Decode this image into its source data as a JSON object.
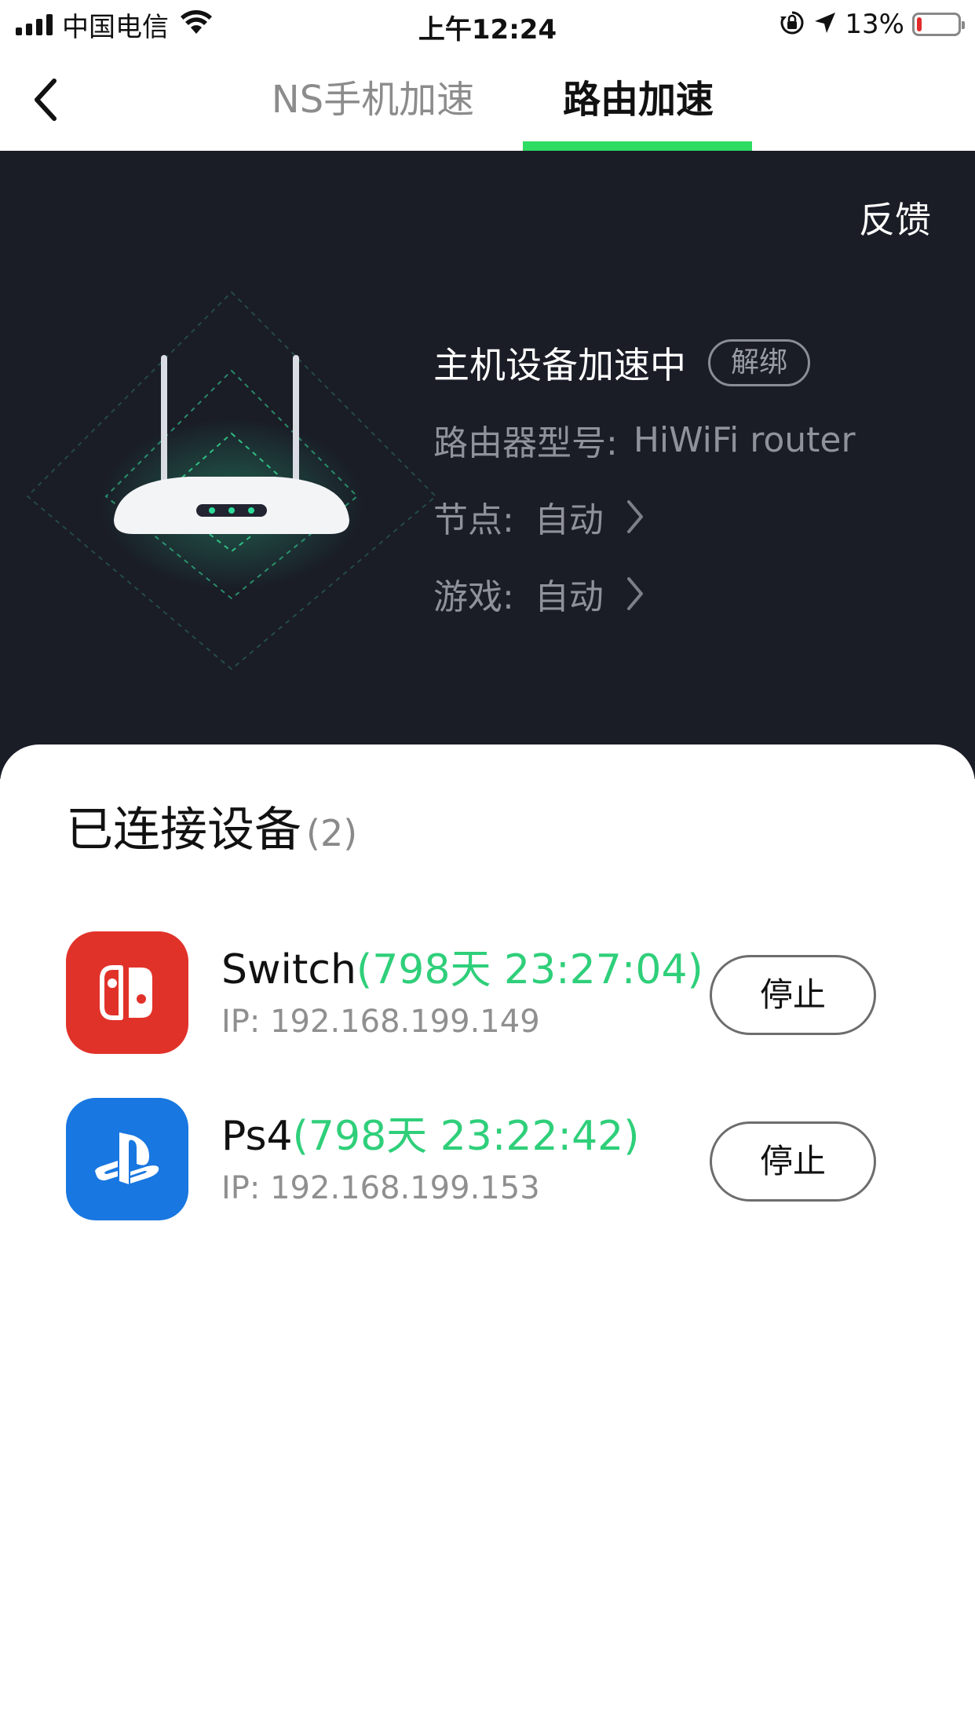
{
  "status_bar": {
    "carrier": "中国电信",
    "time": "上午12:24",
    "battery_percent": "13%",
    "battery_level": 0.13,
    "icons": [
      "signal-icon",
      "wifi-icon",
      "rotation-lock-icon",
      "location-icon",
      "battery-icon"
    ]
  },
  "nav": {
    "tabs": [
      {
        "label": "NS手机加速",
        "active": false
      },
      {
        "label": "路由加速",
        "active": true
      }
    ],
    "accent_color": "#2ddc63"
  },
  "hero": {
    "feedback_label": "反馈",
    "host_status": "主机设备加速中",
    "unbind_label": "解绑",
    "router_model_label": "路由器型号:",
    "router_model_value": "HiWiFi router",
    "node_label": "节点:",
    "node_value": "自动",
    "game_label": "游戏:",
    "game_value": "自动"
  },
  "devices_section": {
    "title": "已连接设备",
    "count": "(2)",
    "devices": [
      {
        "name": "Switch",
        "uptime": "(798天 23:27:04)",
        "ip": "IP: 192.168.199.149",
        "stop_label": "停止",
        "icon": "nintendo-switch-icon",
        "icon_color": "#e1322a"
      },
      {
        "name": "Ps4",
        "uptime": "(798天 23:22:42)",
        "ip": "IP: 192.168.199.153",
        "stop_label": "停止",
        "icon": "playstation-icon",
        "icon_color": "#1877e0"
      }
    ]
  }
}
